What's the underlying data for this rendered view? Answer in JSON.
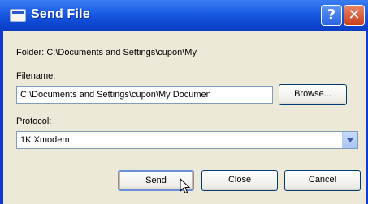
{
  "window": {
    "title": "Send File",
    "help_glyph": "?",
    "close_glyph": "✕"
  },
  "folder": {
    "label": "Folder:",
    "path": "C:\\Documents and Settings\\cupon\\My"
  },
  "filename": {
    "label": "Filename:",
    "value": "C:\\Documents and Settings\\cupon\\My Documen",
    "browse_label": "Browse..."
  },
  "protocol": {
    "label": "Protocol:",
    "selected": "1K Xmodem"
  },
  "buttons": {
    "send": "Send",
    "close": "Close",
    "cancel": "Cancel"
  },
  "icons": [
    "app-icon",
    "help-icon",
    "close-icon",
    "dropdown-arrow-icon",
    "mouse-pointer-icon"
  ]
}
